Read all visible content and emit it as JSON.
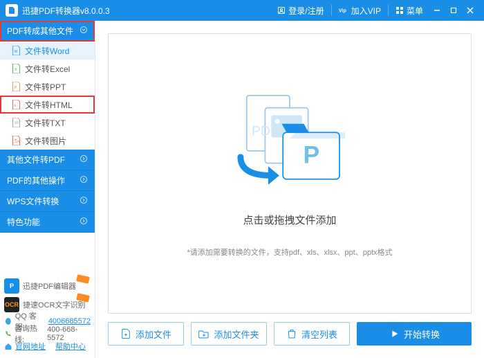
{
  "titlebar": {
    "title": "迅捷PDF转换器v8.0.0.3",
    "login": "登录/注册",
    "vip": "加入VIP",
    "menu": "菜单"
  },
  "sidebar": {
    "cats": [
      {
        "label": "PDF转成其他文件",
        "expanded": true
      },
      {
        "label": "其他文件转PDF"
      },
      {
        "label": "PDF的其他操作"
      },
      {
        "label": "WPS文件转换"
      },
      {
        "label": "特色功能"
      }
    ],
    "subs": [
      {
        "label": "文件转Word"
      },
      {
        "label": "文件转Excel"
      },
      {
        "label": "文件转PPT"
      },
      {
        "label": "文件转HTML"
      },
      {
        "label": "文件转TXT"
      },
      {
        "label": "文件转图片"
      }
    ]
  },
  "promo": {
    "editor": "迅捷PDF编辑器",
    "ocr": "捷速OCR文字识别",
    "qq_label": "QQ 客服:",
    "qq_value": "4006685572",
    "tel_label": "咨询热线:",
    "tel_value": "400-668-5572",
    "site_label": "官网地址",
    "help_label": "帮助中心"
  },
  "drop": {
    "message": "点击或拖拽文件添加",
    "hint": "*请添加需要转换的文件，支持pdf、xls、xlsx、ppt、pptx格式"
  },
  "actions": {
    "add_file": "添加文件",
    "add_folder": "添加文件夹",
    "clear": "清空列表",
    "start": "开始转换"
  },
  "colors": {
    "primary": "#1a8ee6",
    "highlight": "#e03a3a"
  }
}
